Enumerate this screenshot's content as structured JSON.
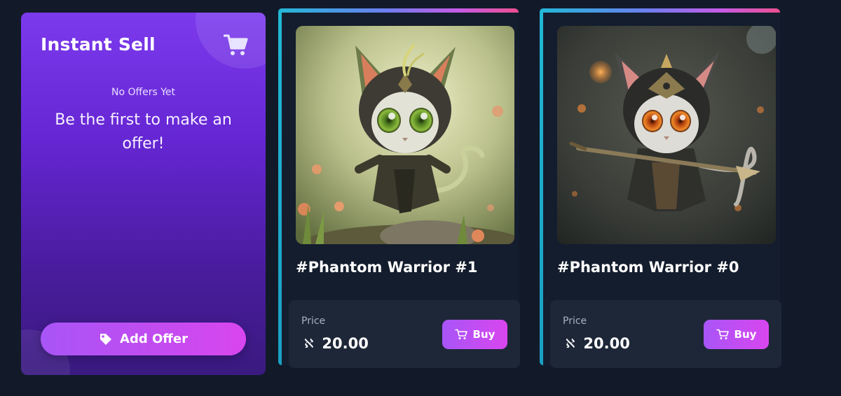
{
  "instant_sell": {
    "title": "Instant Sell",
    "cart_icon": "cart-icon",
    "status": "No Offers Yet",
    "message": "Be the first to make an offer!",
    "add_offer_label": "Add Offer",
    "add_offer_icon": "tag-icon",
    "accent": "#7c3aed"
  },
  "nfts": [
    {
      "name": "#Phantom Warrior #1",
      "image": "phantom-warrior-1-image",
      "price_label": "Price",
      "currency_symbol": "ℵ",
      "price": "20.00",
      "buy_label": "Buy"
    },
    {
      "name": "#Phantom Warrior #0",
      "image": "phantom-warrior-0-image",
      "price_label": "Price",
      "currency_symbol": "ℵ",
      "price": "20.00",
      "buy_label": "Buy"
    }
  ],
  "colors": {
    "background": "#121a2a",
    "card": "#141d2d",
    "price_box": "#1e2738",
    "button_gradient_start": "#a855f7",
    "button_gradient_end": "#d946ef",
    "border_cyan": "#22b8d6",
    "border_pink": "#ec4f8f"
  }
}
